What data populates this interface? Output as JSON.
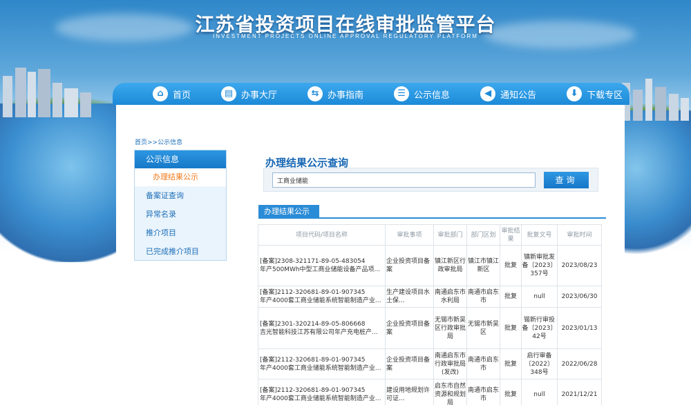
{
  "site": {
    "title": "江苏省投资项目在线审批监管平台",
    "subtitle": "INVESTMENT PROJECTS ONLINE APPROVAL REGULATORY PLATFORM"
  },
  "nav": [
    {
      "label": "首页",
      "icon": "home-icon",
      "glyph": "⌂"
    },
    {
      "label": "办事大厅",
      "icon": "book-icon",
      "glyph": "▤"
    },
    {
      "label": "办事指南",
      "icon": "signpost-icon",
      "glyph": "⇆"
    },
    {
      "label": "公示信息",
      "icon": "chat-icon",
      "glyph": "☰"
    },
    {
      "label": "通知公告",
      "icon": "speaker-icon",
      "glyph": "◀"
    },
    {
      "label": "下载专区",
      "icon": "download-icon",
      "glyph": "⬇"
    }
  ],
  "breadcrumb": "首页>>公示信息",
  "sidebar": {
    "head": "公示信息",
    "sub": "办理结果公示",
    "items": [
      "备案证查询",
      "异常名录",
      "推介项目",
      "已完成推介项目"
    ]
  },
  "query": {
    "title": "办理结果公示查询",
    "value": "工商业储能",
    "button": "查询"
  },
  "results": {
    "tab": "办理结果公示",
    "headers": [
      "项目代码/项目名称",
      "审批事项",
      "审批部门",
      "部门区划",
      "审批结果",
      "批复文号",
      "审批时间"
    ],
    "rows": [
      {
        "code": "[备案]2308-321171-89-05-483054",
        "name": "年产500MWh中型工商业储能设备产品项...",
        "item": "企业投资项目备案",
        "dept": "镇江新区行政审批局",
        "area": "镇江市镇江新区",
        "result": "批复",
        "doc": "镇新审批发备〔2023〕357号",
        "time": "2023/08/23"
      },
      {
        "code": "[备案]2112-320681-89-01-907345",
        "name": "年产4000套工商业储能系统智能制造产业...",
        "item": "生产建设项目水土保...",
        "dept": "南通启东市水利局",
        "area": "南通市启东市",
        "result": "批复",
        "doc": "null",
        "time": "2023/06/30"
      },
      {
        "code": "[备案]2301-320214-89-05-806668",
        "name": "吉光智能科技江苏有限公司年产充电桩产...",
        "item": "企业投资项目备案",
        "dept": "无锡市新吴区行政审批局",
        "area": "无锡市新吴区",
        "result": "批复",
        "doc": "锡新行审投备〔2023〕42号",
        "time": "2023/01/13"
      },
      {
        "code": "[备案]2112-320681-89-01-907345",
        "name": "年产4000套工商业储能系统智能制造产业...",
        "item": "企业投资项目备案",
        "dept": "南通启东市行政审批局(发改)",
        "area": "南通市启东市",
        "result": "批复",
        "doc": "启行审备〔2022〕348号",
        "time": "2022/06/28"
      },
      {
        "code": "[备案]2112-320681-89-01-907345",
        "name": "年产4000套工商业储能系统智能制造产业...",
        "item": "建设用地规划许可证...",
        "dept": "启东市自然资源和规划局",
        "area": "南通市启东市",
        "result": "批复",
        "doc": "null",
        "time": "2021/12/21"
      }
    ]
  },
  "colors": {
    "accent": "#1d8ad8",
    "highlight": "#f07a1c",
    "title_blue": "#1766b3"
  }
}
